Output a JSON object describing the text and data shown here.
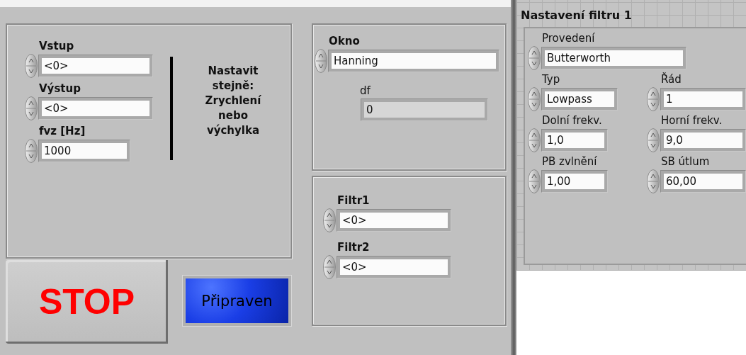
{
  "settings_panel": {
    "controls": [
      {
        "label": "Vstup",
        "value": "<0>"
      },
      {
        "label": "Výstup",
        "value": "<0>"
      },
      {
        "label": "fvz [Hz]",
        "value": "1000"
      }
    ],
    "note": "Nastavit\nstejně:\nZrychlení\nnebo\nvýchylka"
  },
  "stop_button": {
    "label": "STOP"
  },
  "status_indicator": {
    "label": "Připraven",
    "on": true
  },
  "window_panel": {
    "controls": [
      {
        "kind": "numeric",
        "label": "Okno",
        "value": "Hanning"
      },
      {
        "kind": "indicator",
        "label": "df",
        "value": "0"
      }
    ]
  },
  "filter_panel": {
    "controls": [
      {
        "label": "Filtr1",
        "value": "<0>"
      },
      {
        "label": "Filtr2",
        "value": "<0>"
      }
    ]
  },
  "filter_settings": {
    "title": "Nastavení filtru 1",
    "controls": [
      {
        "label": "Provedení",
        "value": "Butterworth"
      },
      {
        "label": "Typ",
        "value": "Lowpass"
      },
      {
        "label": "Řád",
        "value": "1"
      },
      {
        "label": "Dolní frekv.",
        "value": "1,0"
      },
      {
        "label": "Horní frekv.",
        "value": "9,0"
      },
      {
        "label": "PB zvlnění",
        "value": "1,00"
      },
      {
        "label": "SB útlum",
        "value": "60,00"
      }
    ]
  }
}
